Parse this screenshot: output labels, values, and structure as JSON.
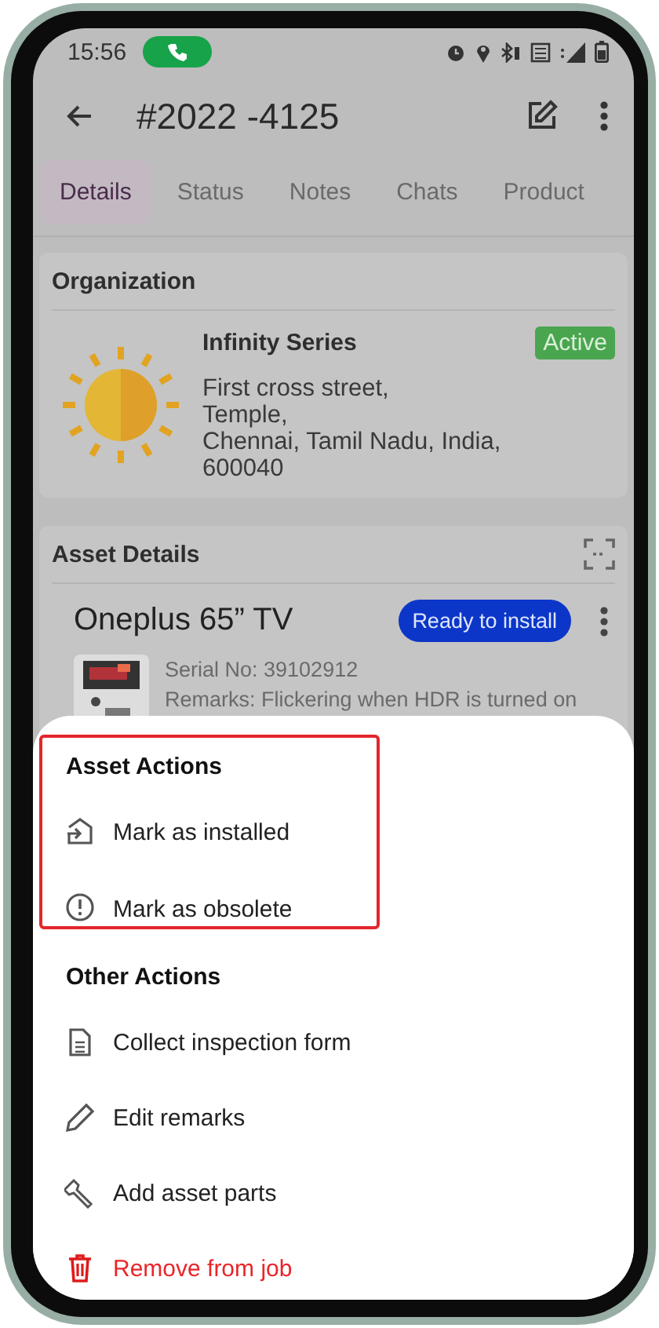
{
  "status_bar": {
    "time": "15:56"
  },
  "app_bar": {
    "title": "#2022 -4125"
  },
  "tabs": [
    {
      "label": "Details",
      "selected": true
    },
    {
      "label": "Status",
      "selected": false
    },
    {
      "label": "Notes",
      "selected": false
    },
    {
      "label": "Chats",
      "selected": false
    },
    {
      "label": "Product",
      "selected": false
    }
  ],
  "organization": {
    "heading": "Organization",
    "name": "Infinity Series",
    "status": "Active",
    "address_lines": [
      "First cross street,",
      "Temple,",
      "Chennai, Tamil Nadu, India,",
      "600040"
    ]
  },
  "asset_details": {
    "heading": "Asset Details",
    "asset_name": "Oneplus 65” TV",
    "status": "Ready to install",
    "serial": "Serial No: 39102912",
    "remarks": "Remarks: Flickering when HDR is turned on"
  },
  "sheet": {
    "sections": [
      {
        "title": "Asset Actions",
        "highlighted": true,
        "items": [
          {
            "label": "Mark as installed",
            "kind": "normal"
          },
          {
            "label": "Mark as obsolete",
            "kind": "normal"
          }
        ]
      },
      {
        "title": "Other Actions",
        "highlighted": false,
        "items": [
          {
            "label": "Collect inspection form",
            "kind": "normal"
          },
          {
            "label": "Edit remarks",
            "kind": "normal"
          },
          {
            "label": "Add asset parts",
            "kind": "normal"
          },
          {
            "label": "Remove from job",
            "kind": "danger"
          }
        ]
      }
    ]
  }
}
